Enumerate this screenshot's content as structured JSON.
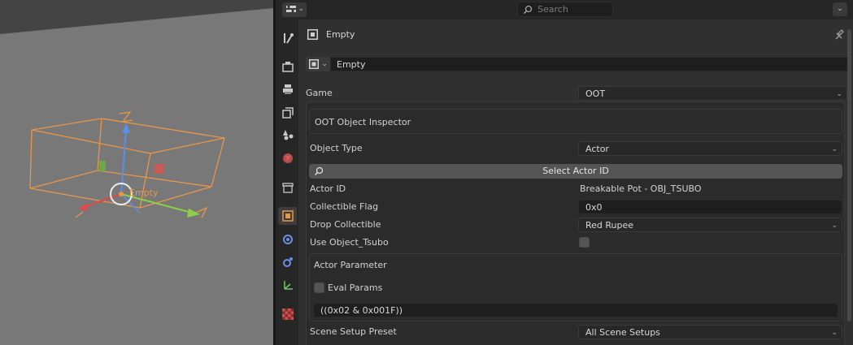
{
  "viewport": {
    "object_label": "Empty",
    "colors": {
      "bg": "#787878",
      "cage": "#e8964a",
      "x_axis": "#e04848",
      "y_axis": "#8cd04a",
      "z_axis": "#5a90e8"
    }
  },
  "header": {
    "search_placeholder": "Search",
    "editor_icon": "properties-editor-icon",
    "menu_icon": "chevron-down-icon"
  },
  "tabs": [
    {
      "name": "tool",
      "icon": "wrench-screwdriver-icon"
    },
    {
      "name": "render",
      "icon": "camera-back-icon"
    },
    {
      "name": "output",
      "icon": "printer-icon"
    },
    {
      "name": "view-layer",
      "icon": "images-stack-icon"
    },
    {
      "name": "scene",
      "icon": "scene-cone-sphere-icon"
    },
    {
      "name": "world",
      "icon": "world-globe-icon"
    },
    {
      "name": "collection",
      "icon": "collection-box-icon"
    },
    {
      "name": "object",
      "icon": "object-square-icon",
      "active": true
    },
    {
      "name": "modifiers",
      "icon": "blue-circle-icon"
    },
    {
      "name": "physics",
      "icon": "orbit-icon"
    },
    {
      "name": "constraints",
      "icon": "axis-icon"
    },
    {
      "name": "texture",
      "icon": "checker-icon"
    }
  ],
  "context": {
    "object_name": "Empty",
    "datablock_name": "Empty",
    "pin_icon": "pin-icon"
  },
  "game": {
    "label": "Game",
    "value": "OOT"
  },
  "inspector": {
    "title": "OOT Object Inspector",
    "object_type": {
      "label": "Object Type",
      "value": "Actor"
    },
    "select_button": "Select Actor ID",
    "actor_id": {
      "label": "Actor ID",
      "value": "Breakable Pot - OBJ_TSUBO"
    },
    "collectible_flag": {
      "label": "Collectible Flag",
      "value": "0x0"
    },
    "drop_collectible": {
      "label": "Drop Collectible",
      "value": "Red Rupee"
    },
    "use_object": {
      "label": "Use Object_Tsubo",
      "checked": false
    },
    "actor_parameter": {
      "title": "Actor Parameter",
      "eval_params": {
        "label": "Eval Params",
        "checked": false
      },
      "expression": "((0x02 & 0x001F))"
    },
    "scene_setup": {
      "label": "Scene Setup Preset",
      "value": "All Scene Setups"
    }
  }
}
